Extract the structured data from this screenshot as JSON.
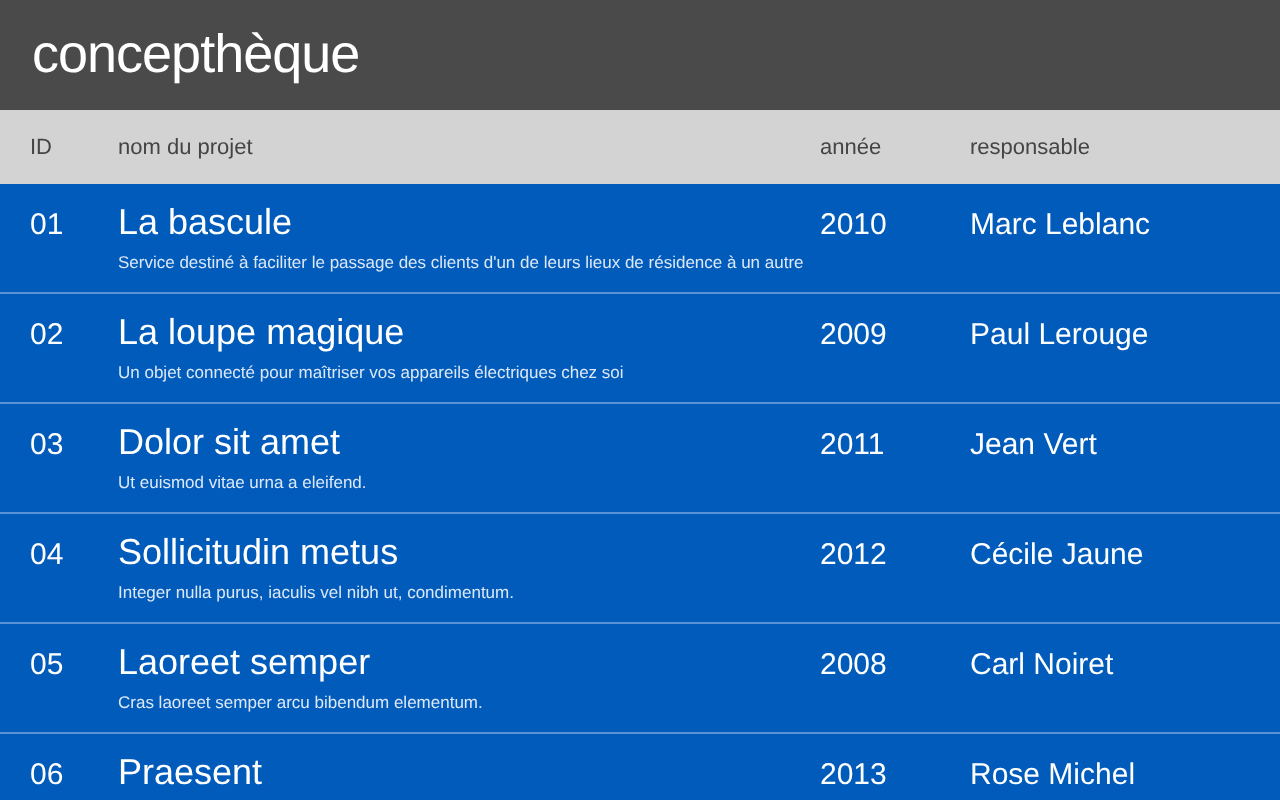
{
  "app": {
    "title": "concepthèque"
  },
  "table": {
    "columns": [
      "ID",
      "nom du projet",
      "année",
      "responsable"
    ],
    "rows": [
      {
        "id": "01",
        "name": "La bascule",
        "description": "Service destiné à faciliter le passage des clients d'un de leurs lieux de résidence à un autre",
        "year": "2010",
        "owner": "Marc Leblanc"
      },
      {
        "id": "02",
        "name": "La loupe magique",
        "description": "Un objet connecté pour maîtriser vos appareils électriques chez soi",
        "year": "2009",
        "owner": "Paul Lerouge"
      },
      {
        "id": "03",
        "name": "Dolor sit amet",
        "description": "Ut euismod vitae urna a eleifend.",
        "year": "2011",
        "owner": "Jean Vert"
      },
      {
        "id": "04",
        "name": "Sollicitudin metus",
        "description": "Integer nulla purus, iaculis vel nibh ut, condimentum.",
        "year": "2012",
        "owner": "Cécile Jaune"
      },
      {
        "id": "05",
        "name": "Laoreet semper",
        "description": "Cras laoreet semper arcu bibendum elementum.",
        "year": "2008",
        "owner": "Carl Noiret"
      },
      {
        "id": "06",
        "name": "Praesent",
        "year": "2013",
        "owner": "Rose Michel"
      }
    ]
  }
}
